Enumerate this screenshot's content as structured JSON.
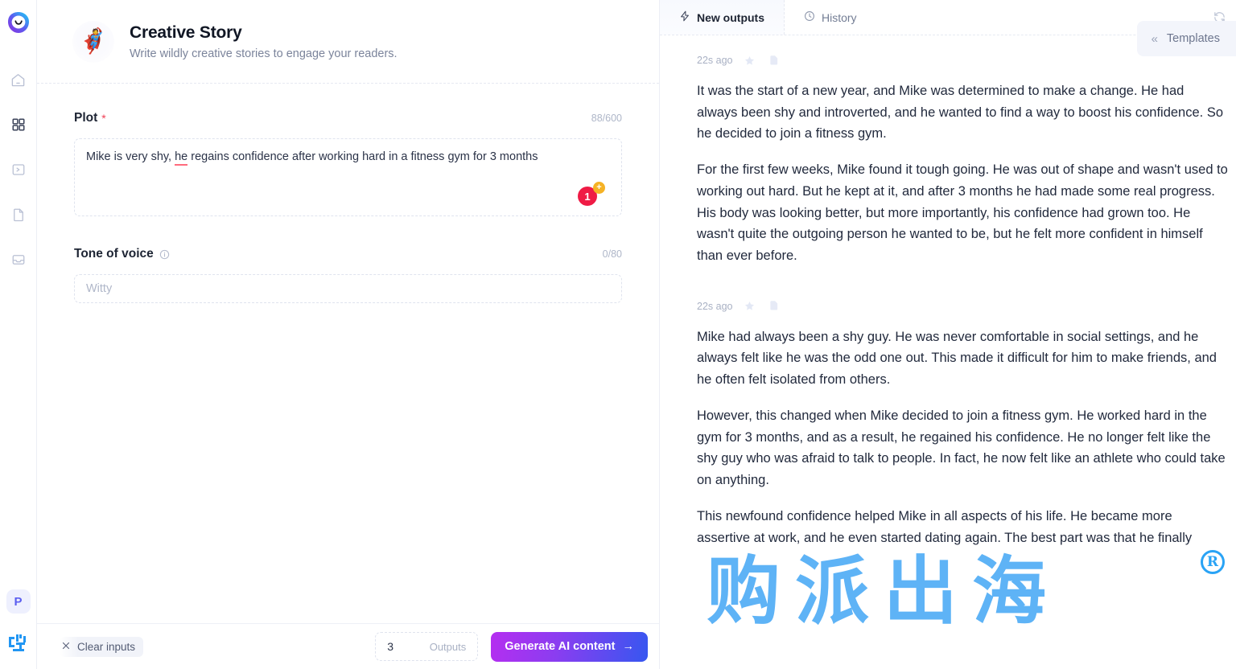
{
  "sidebar": {
    "logo_icon": "brand-logo-icon",
    "items": [
      {
        "icon": "home-icon",
        "name": "home"
      },
      {
        "icon": "grid-apps-icon",
        "name": "apps"
      },
      {
        "icon": "console-icon",
        "name": "console"
      },
      {
        "icon": "document-icon",
        "name": "documents"
      },
      {
        "icon": "inbox-icon",
        "name": "inbox"
      }
    ],
    "avatar_initial": "P"
  },
  "header": {
    "emoji": "🦸",
    "title": "Creative Story",
    "subtitle": "Write wildly creative stories to engage your readers.",
    "templates_label": "Templates",
    "templates_chevron": "«"
  },
  "form": {
    "plot": {
      "label": "Plot",
      "required_mark": "*",
      "counter": "88/600",
      "value_before": "Mike is very shy, ",
      "value_misspelled": "he",
      "value_after": " regains confidence after working hard in a fitness gym for 3 months",
      "badge_count": "1",
      "badge_plus": "+"
    },
    "tone": {
      "label": "Tone of voice",
      "counter": "0/80",
      "placeholder": "Witty",
      "value": ""
    }
  },
  "actions": {
    "clear_label": "Clear inputs",
    "clear_icon": "close-x-icon",
    "outputs_value": "3",
    "outputs_label": "Outputs",
    "generate_label": "Generate AI content",
    "generate_arrow": "→"
  },
  "output_panel": {
    "tabs": [
      {
        "label": "New outputs",
        "icon": "lightning-icon",
        "active": true
      },
      {
        "label": "History",
        "icon": "clock-icon",
        "active": false
      }
    ],
    "refresh_icon": "refresh-icon",
    "results": [
      {
        "time": "22s ago",
        "paragraphs": [
          "It was the start of a new year, and Mike was determined to make a change. He had always been shy and introverted, and he wanted to find a way to boost his confidence. So he decided to join a fitness gym.",
          "For the first few weeks, Mike found it tough going. He was out of shape and wasn't used to working out hard. But he kept at it, and after 3 months he had made some real progress. His body was looking better, but more importantly, his confidence had grown too. He wasn't quite the outgoing person he wanted to be, but he felt more confident in himself than ever before."
        ]
      },
      {
        "time": "22s ago",
        "paragraphs": [
          "Mike had always been a shy guy. He was never comfortable in social settings, and he always felt like he was the odd one out. This made it difficult for him to make friends, and he often felt isolated from others.",
          "However, this changed when Mike decided to join a fitness gym. He worked hard in the gym for 3 months, and as a result, he regained his confidence. He no longer felt like the shy guy who was afraid to talk to people. In fact, he now felt like an athlete who could take on anything.",
          "This newfound confidence helped Mike in all aspects of his life. He became more assertive at work, and he even started dating again. The best part was that he finally"
        ]
      }
    ]
  },
  "watermark": {
    "text": "购派出海",
    "registered_mark": "R",
    "color": "#2196f3"
  }
}
